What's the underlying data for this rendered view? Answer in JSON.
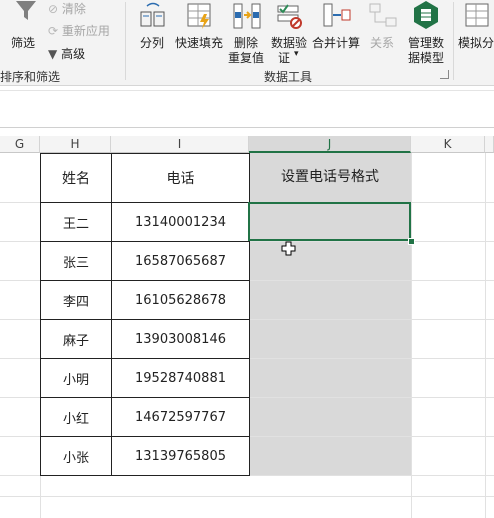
{
  "ribbon": {
    "filter_label": "筛选",
    "clear_label": "清除",
    "reapply_label": "重新应用",
    "advanced_label": "高级",
    "sort_filter_group": "排序和筛选",
    "split_label": "分列",
    "flash_fill_label": "快速填充",
    "remove_dup_line1": "删除",
    "remove_dup_line2": "重复值",
    "validation_line1": "数据验",
    "validation_line2": "证",
    "consolidate_label": "合并计算",
    "relationships_label": "关系",
    "manage_model_line1": "管理数",
    "manage_model_line2": "据模型",
    "data_tools_group": "数据工具",
    "whatif_label": "模拟分",
    "accent": "#217346"
  },
  "columns": [
    "G",
    "H",
    "I",
    "J",
    "K"
  ],
  "table": {
    "header": [
      "姓名",
      "电话",
      "设置电话号格式"
    ],
    "rows": [
      {
        "name": "王二",
        "phone": "13140001234"
      },
      {
        "name": "张三",
        "phone": "16587065687"
      },
      {
        "name": "李四",
        "phone": "16105628678"
      },
      {
        "name": "麻子",
        "phone": "13903008146"
      },
      {
        "name": "小明",
        "phone": "19528740881"
      },
      {
        "name": "小红",
        "phone": "14672597767"
      },
      {
        "name": "小张",
        "phone": "13139765805"
      }
    ]
  }
}
